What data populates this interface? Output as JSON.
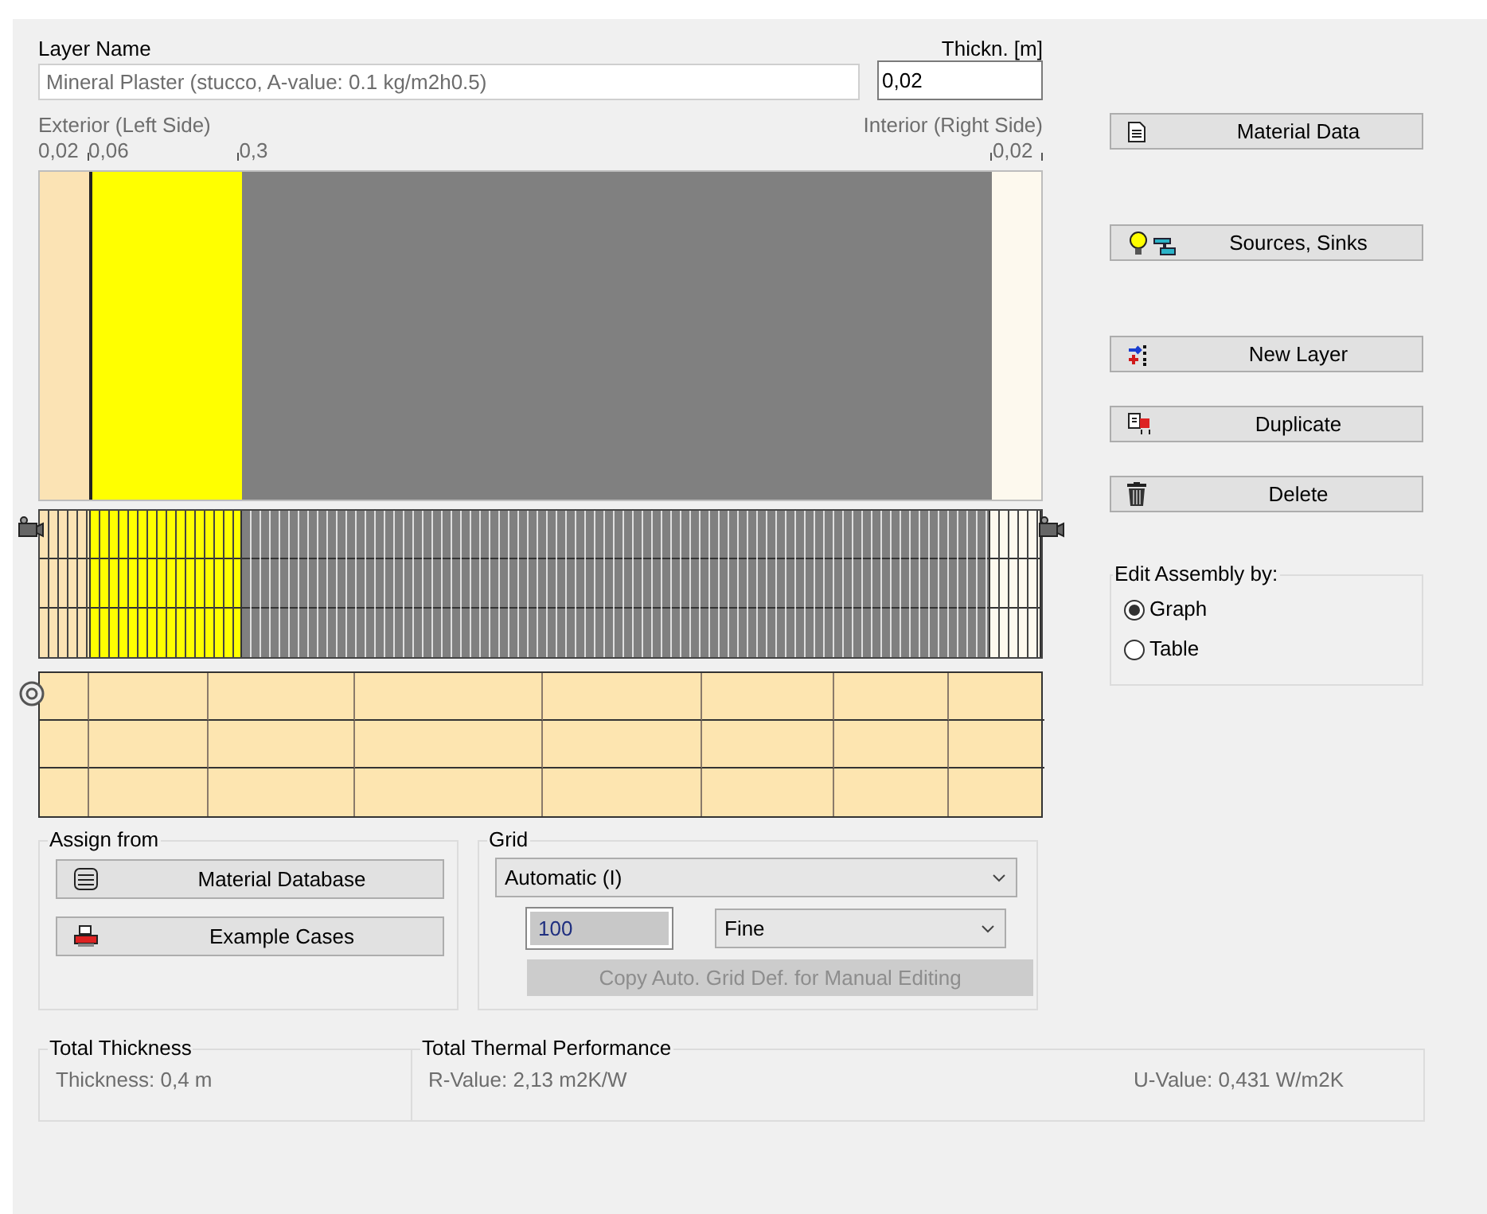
{
  "layer_name": {
    "label": "Layer Name",
    "value": "Mineral Plaster (stucco, A-value: 0.1 kg/m2h0.5)"
  },
  "thickness": {
    "label": "Thickn. [m]",
    "value": "0,02"
  },
  "assembly": {
    "exterior_label": "Exterior (Left Side)",
    "interior_label": "Interior (Right Side)",
    "layers": [
      {
        "thickness": "0,02",
        "color": "#fbe3b4",
        "selected": true
      },
      {
        "thickness": "0,06",
        "color": "#ffff00",
        "selected": false
      },
      {
        "thickness": "0,3",
        "color": "#808080",
        "selected": false
      },
      {
        "thickness": "0,02",
        "color": "#fdf9ee",
        "selected": false
      }
    ]
  },
  "side_buttons": [
    {
      "label": "Material Data",
      "kind": "document"
    },
    {
      "label": "Sources, Sinks",
      "kind": "sources"
    },
    {
      "label": "New Layer",
      "kind": "newlayer"
    },
    {
      "label": "Duplicate",
      "kind": "duplicate"
    },
    {
      "label": "Delete",
      "kind": "delete"
    }
  ],
  "edit_assembly": {
    "title": "Edit Assembly by:",
    "options": [
      {
        "label": "Graph",
        "selected": true
      },
      {
        "label": "Table",
        "selected": false
      }
    ]
  },
  "assign_from": {
    "title": "Assign from",
    "buttons": [
      {
        "label": "Material Database",
        "kind": "database"
      },
      {
        "label": "Example Cases",
        "kind": "cases"
      }
    ]
  },
  "grid": {
    "title": "Grid",
    "mode": "Automatic (I)",
    "count": "100",
    "resolution": "Fine",
    "copy_button": {
      "label": "Copy Auto. Grid Def. for Manual Editing",
      "disabled": true
    }
  },
  "total_thickness": {
    "title": "Total Thickness",
    "value": "Thickness: 0,4 m"
  },
  "thermal": {
    "title": "Total Thermal Performance",
    "r_value": "R-Value: 2,13 m2K/W",
    "u_value": "U-Value: 0,431 W/m2K"
  }
}
